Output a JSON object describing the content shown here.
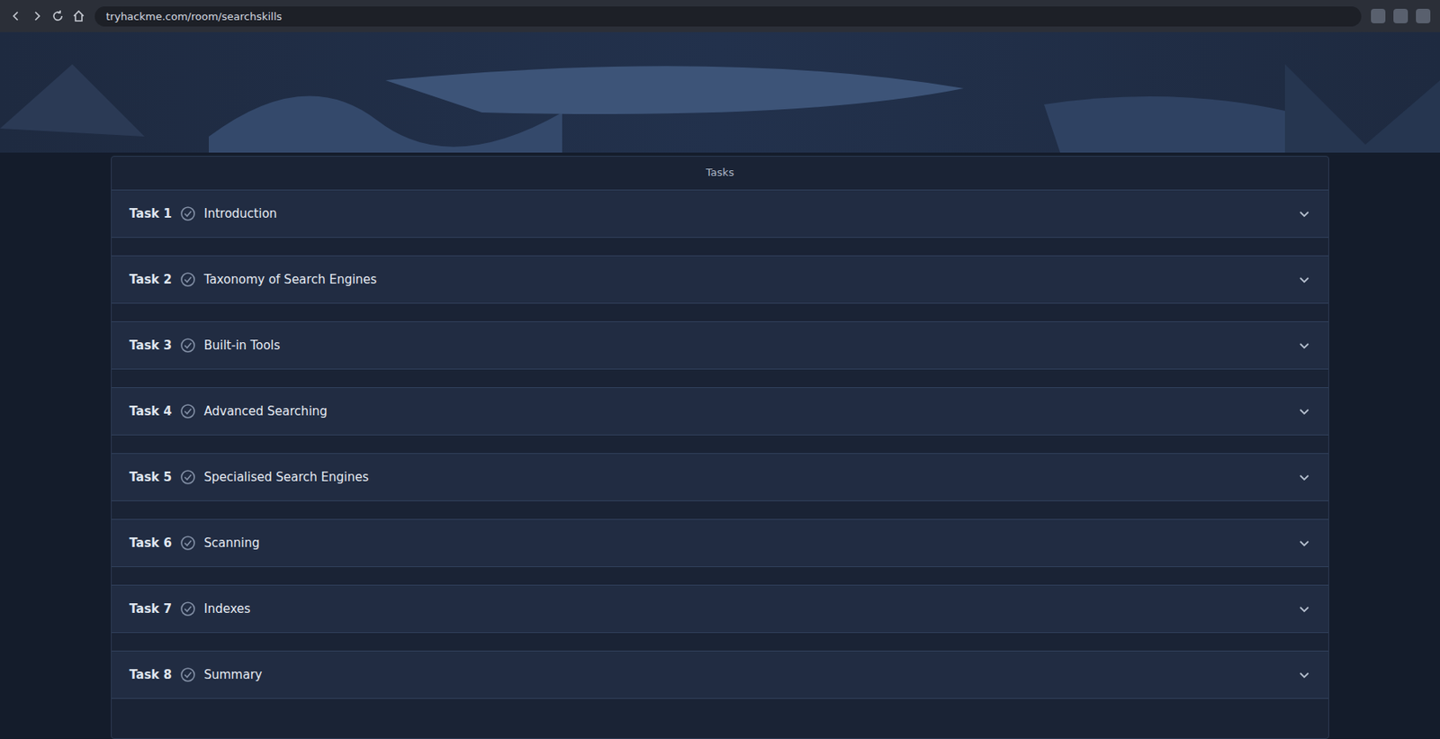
{
  "browser": {
    "url": "tryhackme.com/room/searchskills"
  },
  "task_panel": {
    "title": "Tasks"
  },
  "tasks": [
    {
      "label": "Task 1",
      "title": "Introduction",
      "completed": false,
      "expanded": false
    },
    {
      "label": "Task 2",
      "title": "Taxonomy of Search Engines",
      "completed": false,
      "expanded": false
    },
    {
      "label": "Task 3",
      "title": "Built-in Tools",
      "completed": false,
      "expanded": false
    },
    {
      "label": "Task 4",
      "title": "Advanced Searching",
      "completed": false,
      "expanded": false
    },
    {
      "label": "Task 5",
      "title": "Specialised Search Engines",
      "completed": false,
      "expanded": false
    },
    {
      "label": "Task 6",
      "title": "Scanning",
      "completed": false,
      "expanded": false
    },
    {
      "label": "Task 7",
      "title": "Indexes",
      "completed": false,
      "expanded": false
    },
    {
      "label": "Task 8",
      "title": "Summary",
      "completed": false,
      "expanded": false
    }
  ]
}
